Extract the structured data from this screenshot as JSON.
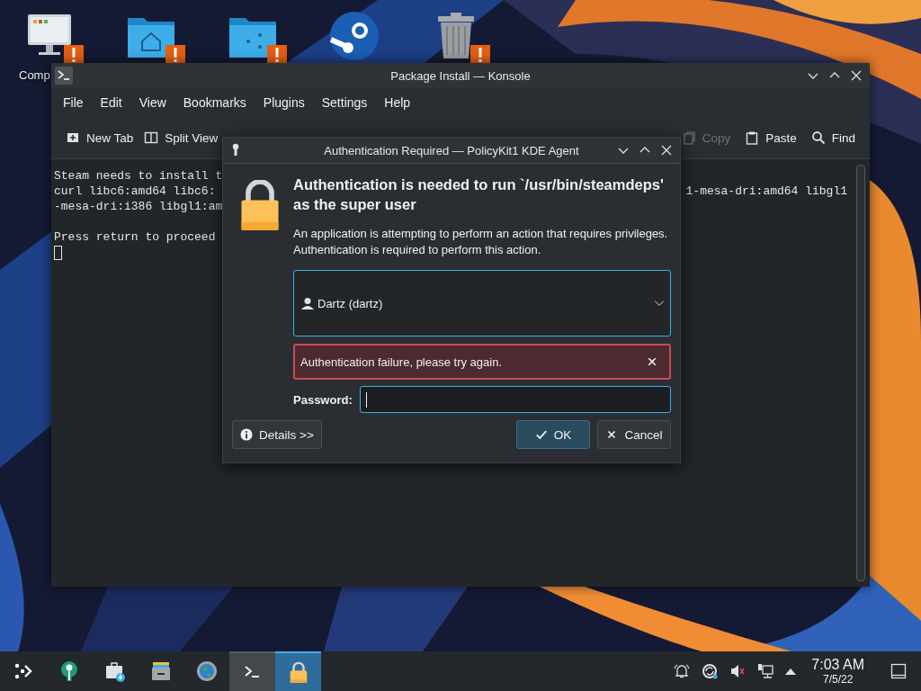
{
  "desktop_icons": [
    {
      "kind": "computer",
      "label": "Comp",
      "warning": true
    },
    {
      "kind": "home-folder",
      "warning": true
    },
    {
      "kind": "network-folder",
      "warning": true
    },
    {
      "kind": "steam",
      "warning": false
    },
    {
      "kind": "trash",
      "warning": true
    }
  ],
  "konsole": {
    "title": "Package Install — Konsole",
    "menu": [
      "File",
      "Edit",
      "View",
      "Bookmarks",
      "Plugins",
      "Settings",
      "Help"
    ],
    "toolbar": [
      {
        "kind": "new-tab",
        "label": "New Tab",
        "disabled": false
      },
      {
        "kind": "split-view",
        "label": "Split View",
        "disabled": false
      },
      {
        "kind": "copy",
        "label": "Copy",
        "disabled": true
      },
      {
        "kind": "paste",
        "label": "Paste",
        "disabled": false
      },
      {
        "kind": "find",
        "label": "Find",
        "disabled": false
      }
    ],
    "terminal_lines": [
      {
        "left": "Steam needs to install t"
      },
      {
        "left": "curl libc6:amd64 libc6:",
        "right": "1-mesa-dri:amd64 libgl1"
      },
      {
        "left": "-mesa-dri:i386 libgl1:am"
      },
      {
        "left": "Press return to proceed",
        "gap_before": true
      }
    ]
  },
  "dialog": {
    "title": "Authentication Required — PolicyKit1 KDE Agent",
    "heading": "Authentication is needed to run `/usr/bin/steamdeps' as the super user",
    "message": "An application is attempting to perform an action that requires privileges. Authentication is required to perform this action.",
    "user": "Dartz (dartz)",
    "error": "Authentication failure, please try again.",
    "password_label": "Password:",
    "buttons": [
      {
        "kind": "details",
        "label": "Details >>",
        "default": false
      },
      {
        "kind": "ok",
        "label": "OK",
        "default": true
      },
      {
        "kind": "cancel",
        "label": "Cancel",
        "default": false
      }
    ]
  },
  "taskbar": {
    "items": [
      {
        "kind": "launcher",
        "running": false,
        "selected": false
      },
      {
        "kind": "discover",
        "running": false,
        "selected": false
      },
      {
        "kind": "store",
        "running": false,
        "selected": false
      },
      {
        "kind": "files",
        "running": false,
        "selected": false
      },
      {
        "kind": "browser",
        "running": false,
        "selected": false
      },
      {
        "kind": "terminal",
        "running": true,
        "selected": false
      },
      {
        "kind": "lock",
        "running": true,
        "selected": true
      }
    ],
    "tray": [
      {
        "kind": "notifications"
      },
      {
        "kind": "sync"
      },
      {
        "kind": "volume-muted"
      },
      {
        "kind": "network"
      },
      {
        "kind": "expand"
      }
    ],
    "time": "7:03 AM",
    "date": "7/5/22"
  }
}
